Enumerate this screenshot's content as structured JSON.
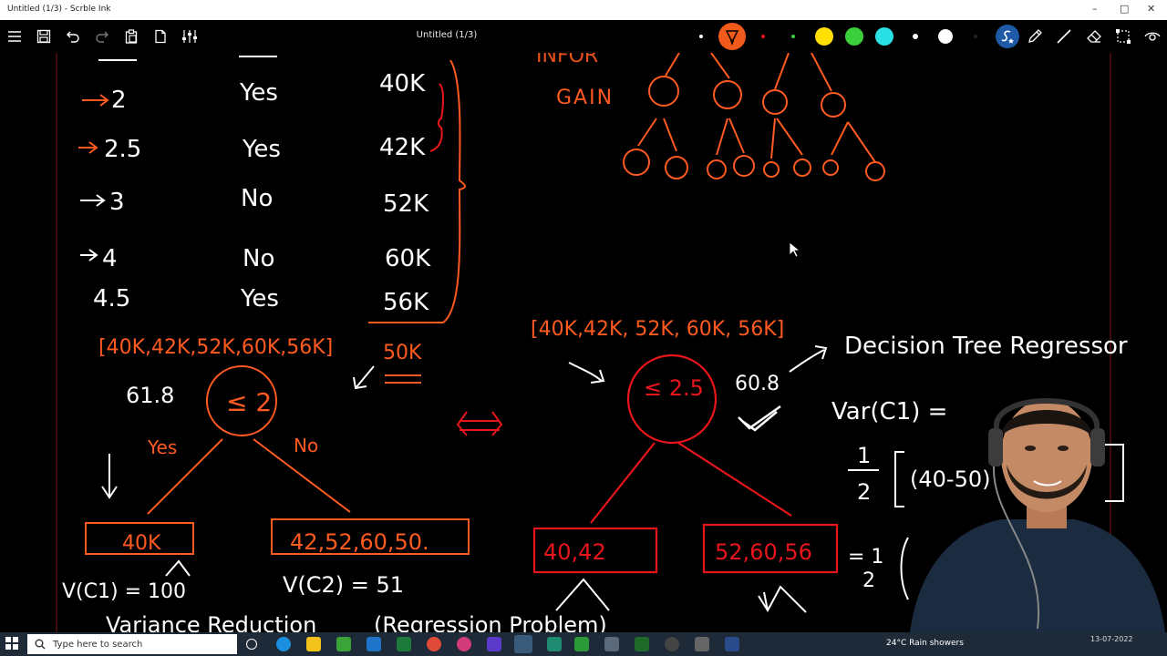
{
  "window": {
    "title": "Untitled (1/3) - Scrble Ink",
    "minimize_glyph": "–",
    "maximize_glyph": "□",
    "close_glyph": "✕"
  },
  "toolbar": {
    "doc_title": "Untitled (1/3)",
    "icons": [
      "menu-icon",
      "save-icon",
      "undo-icon",
      "redo-icon",
      "paste-icon",
      "new-page-icon",
      "settings-sliders-icon"
    ],
    "right_icons": [
      "pen-icon",
      "line-icon",
      "eraser-icon",
      "select-icon",
      "view-icon"
    ],
    "colors": {
      "accent": "#f05a1a",
      "yellow": "#ffe000",
      "green": "#3ccf3c",
      "cyan": "#29e0e6",
      "white": "#ffffff",
      "blue": "#1e5aa8"
    }
  },
  "canvas": {
    "ink_colors": {
      "white": "#ffffff",
      "orange": "#ff5a1f",
      "red": "#e8161c"
    },
    "table": {
      "rows": [
        {
          "x": "2",
          "y": "Yes",
          "salary": "40K"
        },
        {
          "x": "2.5",
          "y": "Yes",
          "salary": "42K"
        },
        {
          "x": "3",
          "y": "No",
          "salary": "52K"
        },
        {
          "x": "4",
          "y": "No",
          "salary": "60K"
        },
        {
          "x": "4.5",
          "y": "Yes",
          "salary": "56K"
        }
      ]
    },
    "info_gain": "GAIN",
    "left_tree": {
      "set_label": "[40K,42K,52K,60K,56K]",
      "mean_value": "61.8",
      "root_label": "≤ 2",
      "yes_label": "Yes",
      "no_label": "No",
      "left_leaf": "40K",
      "right_leaf": "42,52,60,50.",
      "v1": "V(C1) = 100",
      "v2": "V(C2) = 51",
      "side_note": "50K",
      "bottom_text": "Variance Reduction",
      "bottom_text_2": "(Regression Problem)"
    },
    "right_tree": {
      "set_label": "[40K,42K, 52K, 60K, 56K]",
      "root_label": "≤ 2.5",
      "mean_value": "60.8",
      "left_leaf": "40,42",
      "right_leaf": "52,60,56",
      "title": "Decision Tree Regressor",
      "var_label": "Var(C1) =",
      "frac_num": "1",
      "frac_den": "2",
      "bracket_expr": "(40-50)",
      "eq_frac": "= 1",
      "eq_den": "2"
    }
  },
  "taskbar": {
    "search_placeholder": "Type here to search",
    "weather": "24°C  Rain showers",
    "date": "13-07-2022"
  }
}
